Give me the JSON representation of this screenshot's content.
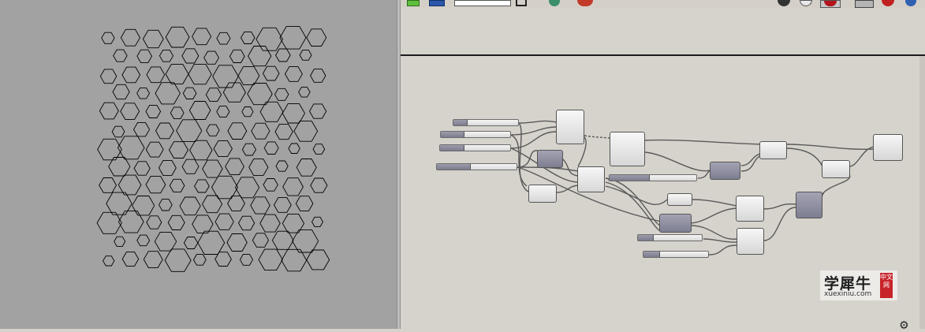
{
  "toolbar": {
    "zoom_value": "",
    "icons": [
      "new-document-icon",
      "save-icon",
      "zoom-field",
      "zoom-extents-icon",
      "preview-icon",
      "sketch-icon",
      "bake-icon",
      "wire-display-icon",
      "preview-red-icon",
      "shaded-preview-icon",
      "render-preview-icon",
      "help-icon"
    ]
  },
  "viewport": {
    "background": "#a2a2a2",
    "stroke": "#000000",
    "content": "hexagon-pattern"
  },
  "canvas": {
    "background": "#d6d3cc",
    "wire_color": "#5a5a5a",
    "component_light": "#e6e6e6",
    "component_dark": "#8e8ea0"
  },
  "watermark": {
    "title": "学犀牛",
    "site": "xuexiniu.com",
    "badge": "中文网"
  }
}
